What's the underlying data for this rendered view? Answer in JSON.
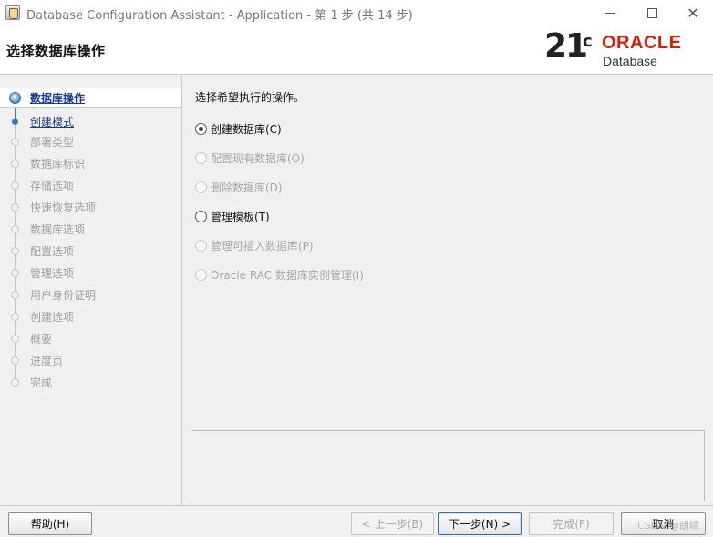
{
  "window": {
    "title": "Database Configuration Assistant - Application - 第 1 步 (共 14 步)"
  },
  "header": {
    "page_title": "选择数据库操作",
    "logo": {
      "version": "21",
      "version_suffix": "c",
      "brand": "ORACLE",
      "product": "Database",
      "brand_color": "#d81e05"
    }
  },
  "sidebar": {
    "steps": [
      {
        "label": "数据库操作",
        "state": "current"
      },
      {
        "label": "创建模式",
        "state": "next"
      },
      {
        "label": "部署类型",
        "state": "disabled"
      },
      {
        "label": "数据库标识",
        "state": "disabled"
      },
      {
        "label": "存储选项",
        "state": "disabled"
      },
      {
        "label": "快速恢复选项",
        "state": "disabled"
      },
      {
        "label": "数据库选项",
        "state": "disabled"
      },
      {
        "label": "配置选项",
        "state": "disabled"
      },
      {
        "label": "管理选项",
        "state": "disabled"
      },
      {
        "label": "用户身份证明",
        "state": "disabled"
      },
      {
        "label": "创建选项",
        "state": "disabled"
      },
      {
        "label": "概要",
        "state": "disabled"
      },
      {
        "label": "进度页",
        "state": "disabled"
      },
      {
        "label": "完成",
        "state": "disabled"
      }
    ]
  },
  "main": {
    "prompt": "选择希望执行的操作。",
    "options": [
      {
        "label": "创建数据库(C)",
        "checked": true,
        "enabled": true
      },
      {
        "label": "配置现有数据库(O)",
        "checked": false,
        "enabled": false
      },
      {
        "label": "删除数据库(D)",
        "checked": false,
        "enabled": false
      },
      {
        "label": "管理模板(T)",
        "checked": false,
        "enabled": true
      },
      {
        "label": "管理可插入数据库(P)",
        "checked": false,
        "enabled": false
      },
      {
        "label": "Oracle RAC 数据库实例管理(I)",
        "checked": false,
        "enabled": false
      }
    ]
  },
  "footer": {
    "help_label": "帮助(H)",
    "back_label": "< 上一步(B)",
    "next_label": "下一步(N) >",
    "finish_label": "完成(F)",
    "cancel_label": "取消",
    "watermark": "CSDN @朗晴"
  }
}
